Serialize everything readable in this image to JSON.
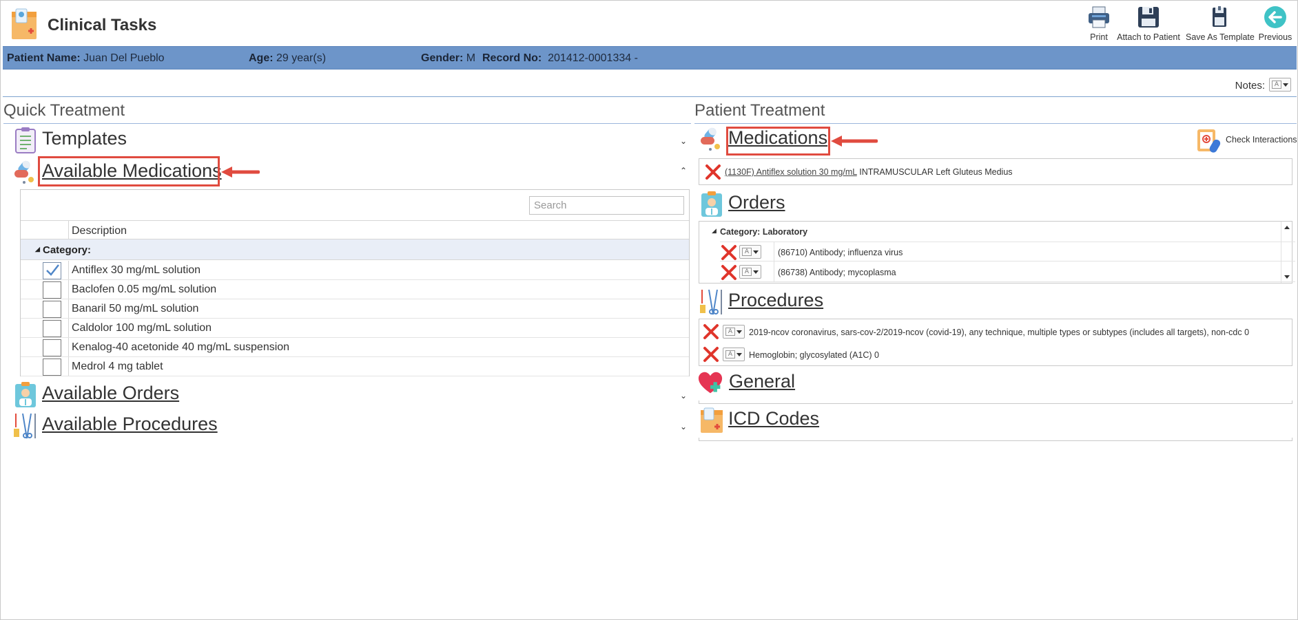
{
  "app": {
    "title": "Clinical Tasks"
  },
  "toolbar": {
    "print": "Print",
    "attach": "Attach to Patient",
    "save_template": "Save As Template",
    "previous": "Previous"
  },
  "patient": {
    "name_label": "Patient Name:",
    "name": "Juan Del Pueblo",
    "age_label": "Age:",
    "age": "29 year(s)",
    "gender_label": "Gender:",
    "gender": "M",
    "record_label": "Record No:",
    "record": "201412-0001334 -"
  },
  "notes": {
    "label": "Notes:"
  },
  "quick_treatment": {
    "title": "Quick Treatment",
    "templates": "Templates",
    "available_medications": "Available Medications",
    "available_orders": "Available Orders",
    "available_procedures": "Available Procedures",
    "search_placeholder": "Search",
    "column_description": "Description",
    "category_label": "Category:",
    "medications": [
      {
        "name": "Antiflex 30 mg/mL solution",
        "checked": true
      },
      {
        "name": "Baclofen 0.05 mg/mL solution",
        "checked": false
      },
      {
        "name": "Banaril 50 mg/mL solution",
        "checked": false
      },
      {
        "name": "Caldolor 100 mg/mL solution",
        "checked": false
      },
      {
        "name": "Kenalog-40 acetonide 40 mg/mL suspension",
        "checked": false
      },
      {
        "name": "Medrol 4 mg tablet",
        "checked": false
      }
    ]
  },
  "patient_treatment": {
    "title": "Patient Treatment",
    "medications": "Medications",
    "check_interactions": "Check Interactions",
    "med_item_link": "(1130F) Antiflex solution 30 mg/mL",
    "med_item_detail": "INTRAMUSCULAR Left Gluteus Medius",
    "orders": "Orders",
    "orders_category": "Category: Laboratory",
    "order_items": [
      "(86710) Antibody; influenza virus",
      "(86738) Antibody; mycoplasma"
    ],
    "procedures": "Procedures",
    "procedure_items": [
      "2019-ncov coronavirus, sars-cov-2/2019-ncov (covid-19), any technique, multiple types or subtypes (includes all targets), non-cdc 0",
      "Hemoglobin; glycosylated (A1C) 0"
    ],
    "general": "General",
    "icd_codes": "ICD Codes"
  },
  "icons": {
    "mini_dropdown_glyph": "A",
    "tri_down": "◢",
    "chev_down": "⌄",
    "chev_up": "⌃"
  }
}
